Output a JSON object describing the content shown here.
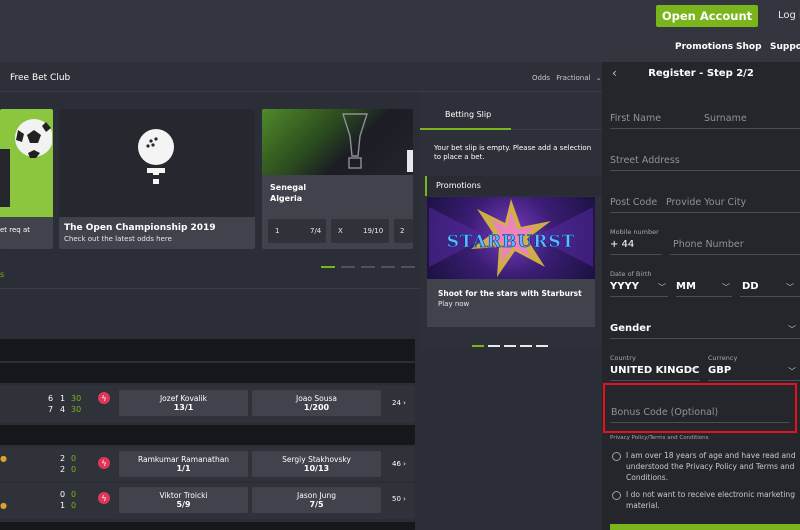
{
  "header": {
    "open_account": "Open Account",
    "login": "Log i",
    "nav": [
      "Promotions",
      "Shop",
      "Support"
    ]
  },
  "subheader": {
    "free_bet_club": "Free Bet Club",
    "odds_label": "Odds",
    "odds_value": "Fractional"
  },
  "cards": {
    "partial_text": "et req at",
    "open_title": "The Open Championship 2019",
    "open_sub": "Check out the latest odds here",
    "match_home": "Senegal",
    "match_away": "Algeria",
    "odds": [
      {
        "label": "1",
        "price": "7/4"
      },
      {
        "label": "X",
        "price": "19/10"
      },
      {
        "label": "2",
        "price": ""
      }
    ]
  },
  "betslip": {
    "tab": "Betting Slip",
    "empty_msg": "Your bet slip is empty. Please add a selection to place a bet.",
    "promotions": "Promotions",
    "promo_logo": "STARBURST",
    "promo_title": "Shoot for the stars with Starburst",
    "promo_cta": "Play now"
  },
  "events": [
    {
      "scores": [
        [
          "6",
          "1",
          "30"
        ],
        [
          "7",
          "4",
          "30"
        ]
      ],
      "p1": {
        "name": "Jozef Kovalik",
        "price": "13/1"
      },
      "p2": {
        "name": "Joao Sousa",
        "price": "1/200"
      },
      "more": "24"
    },
    {
      "scores": [
        [
          "2",
          "0"
        ],
        [
          "2",
          "0"
        ]
      ],
      "p1": {
        "name": "Ramkumar Ramanathan",
        "price": "1/1"
      },
      "p2": {
        "name": "Sergiy Stakhovsky",
        "price": "10/13"
      },
      "more": "46"
    },
    {
      "scores": [
        [
          "0",
          "0"
        ],
        [
          "1",
          "0"
        ]
      ],
      "p1": {
        "name": "Viktor Troicki",
        "price": "5/9"
      },
      "p2": {
        "name": "Jason Jung",
        "price": "7/5"
      },
      "more": "50"
    }
  ],
  "register": {
    "title": "Register - Step 2/2",
    "first_name": "First Name",
    "surname": "Surname",
    "street": "Street Address",
    "post_code": "Post Code",
    "city": "Provide Your City",
    "mobile_label": "Mobile number",
    "mobile_prefix": "+  44",
    "phone": "Phone Number",
    "dob_label": "Date of Birth",
    "yyyy": "YYYY",
    "mm": "MM",
    "dd": "DD",
    "gender": "Gender",
    "country_label": "Country",
    "country": "UNITED KINGDC",
    "currency_label": "Currency",
    "currency": "GBP",
    "bonus": "Bonus Code (Optional)",
    "privacy": "Privacy Policy/Terms and Conditions",
    "consent1": "I am over 18 years of age and have read and understood the Privacy Policy and Terms and Conditions.",
    "consent2": "I do not want to receive electronic marketing material."
  },
  "colors": {
    "accent": "#7ab51d",
    "highlight": "#e0141e",
    "live": "#e0365b"
  }
}
